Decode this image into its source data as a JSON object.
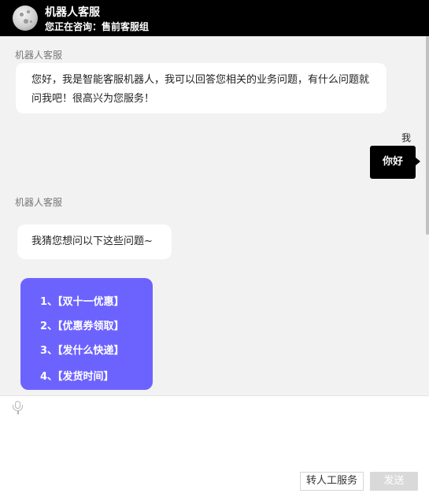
{
  "header": {
    "title": "机器人客服",
    "subtitle": "您正在咨询：售前客服组",
    "avatar_icon": "moon-avatar-icon"
  },
  "messages": {
    "bot_name": "机器人客服",
    "greeting": "您好，我是智能客服机器人，我可以回答您相关的业务问题，有什么问题就问我吧！很高兴为您服务！",
    "user_name": "我",
    "user_message": "你好",
    "guess_prompt": "我猜您想问以下这些问题~"
  },
  "faq": [
    "1、【双十一优惠】",
    "2、【优惠券领取】",
    "3、【发什么快递】",
    "4、【发货时间】"
  ],
  "composer": {
    "mic_icon": "microphone-icon",
    "input_value": "",
    "human_service_label": "转人工服务",
    "send_label": "发送"
  },
  "colors": {
    "header_bg": "#000000",
    "faq_bg": "#6c63ff",
    "user_bubble": "#000000",
    "send_disabled": "#d9d9d9"
  }
}
